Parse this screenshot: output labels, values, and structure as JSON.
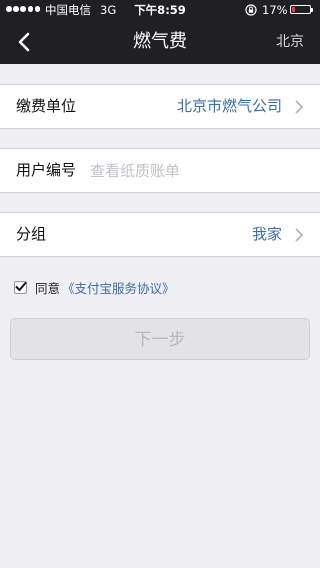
{
  "status_bar": {
    "carrier": "中国电信",
    "network": "3G",
    "time": "下午8:59",
    "battery_percent": "17%",
    "battery_level": 0.17,
    "battery_color": "#ff3b30",
    "icons": [
      "signal-dots-icon",
      "orientation-lock-icon",
      "battery-icon"
    ]
  },
  "nav": {
    "back_icon": "chevron-left-icon",
    "title": "燃气费",
    "city": "北京"
  },
  "form": {
    "unit": {
      "label": "缴费单位",
      "value": "北京市燃气公司"
    },
    "user_id": {
      "label": "用户编号",
      "value": "",
      "placeholder": "查看纸质账单"
    },
    "group": {
      "label": "分组",
      "value": "我家"
    }
  },
  "agreement": {
    "checked": true,
    "text": "同意",
    "link": "《支付宝服务协议》"
  },
  "next_button": {
    "label": "下一步",
    "enabled": false
  },
  "colors": {
    "header_bg": "#1f1f24",
    "page_bg": "#efeff4",
    "link": "#3b6fa8",
    "placeholder": "#c2c2c7"
  }
}
